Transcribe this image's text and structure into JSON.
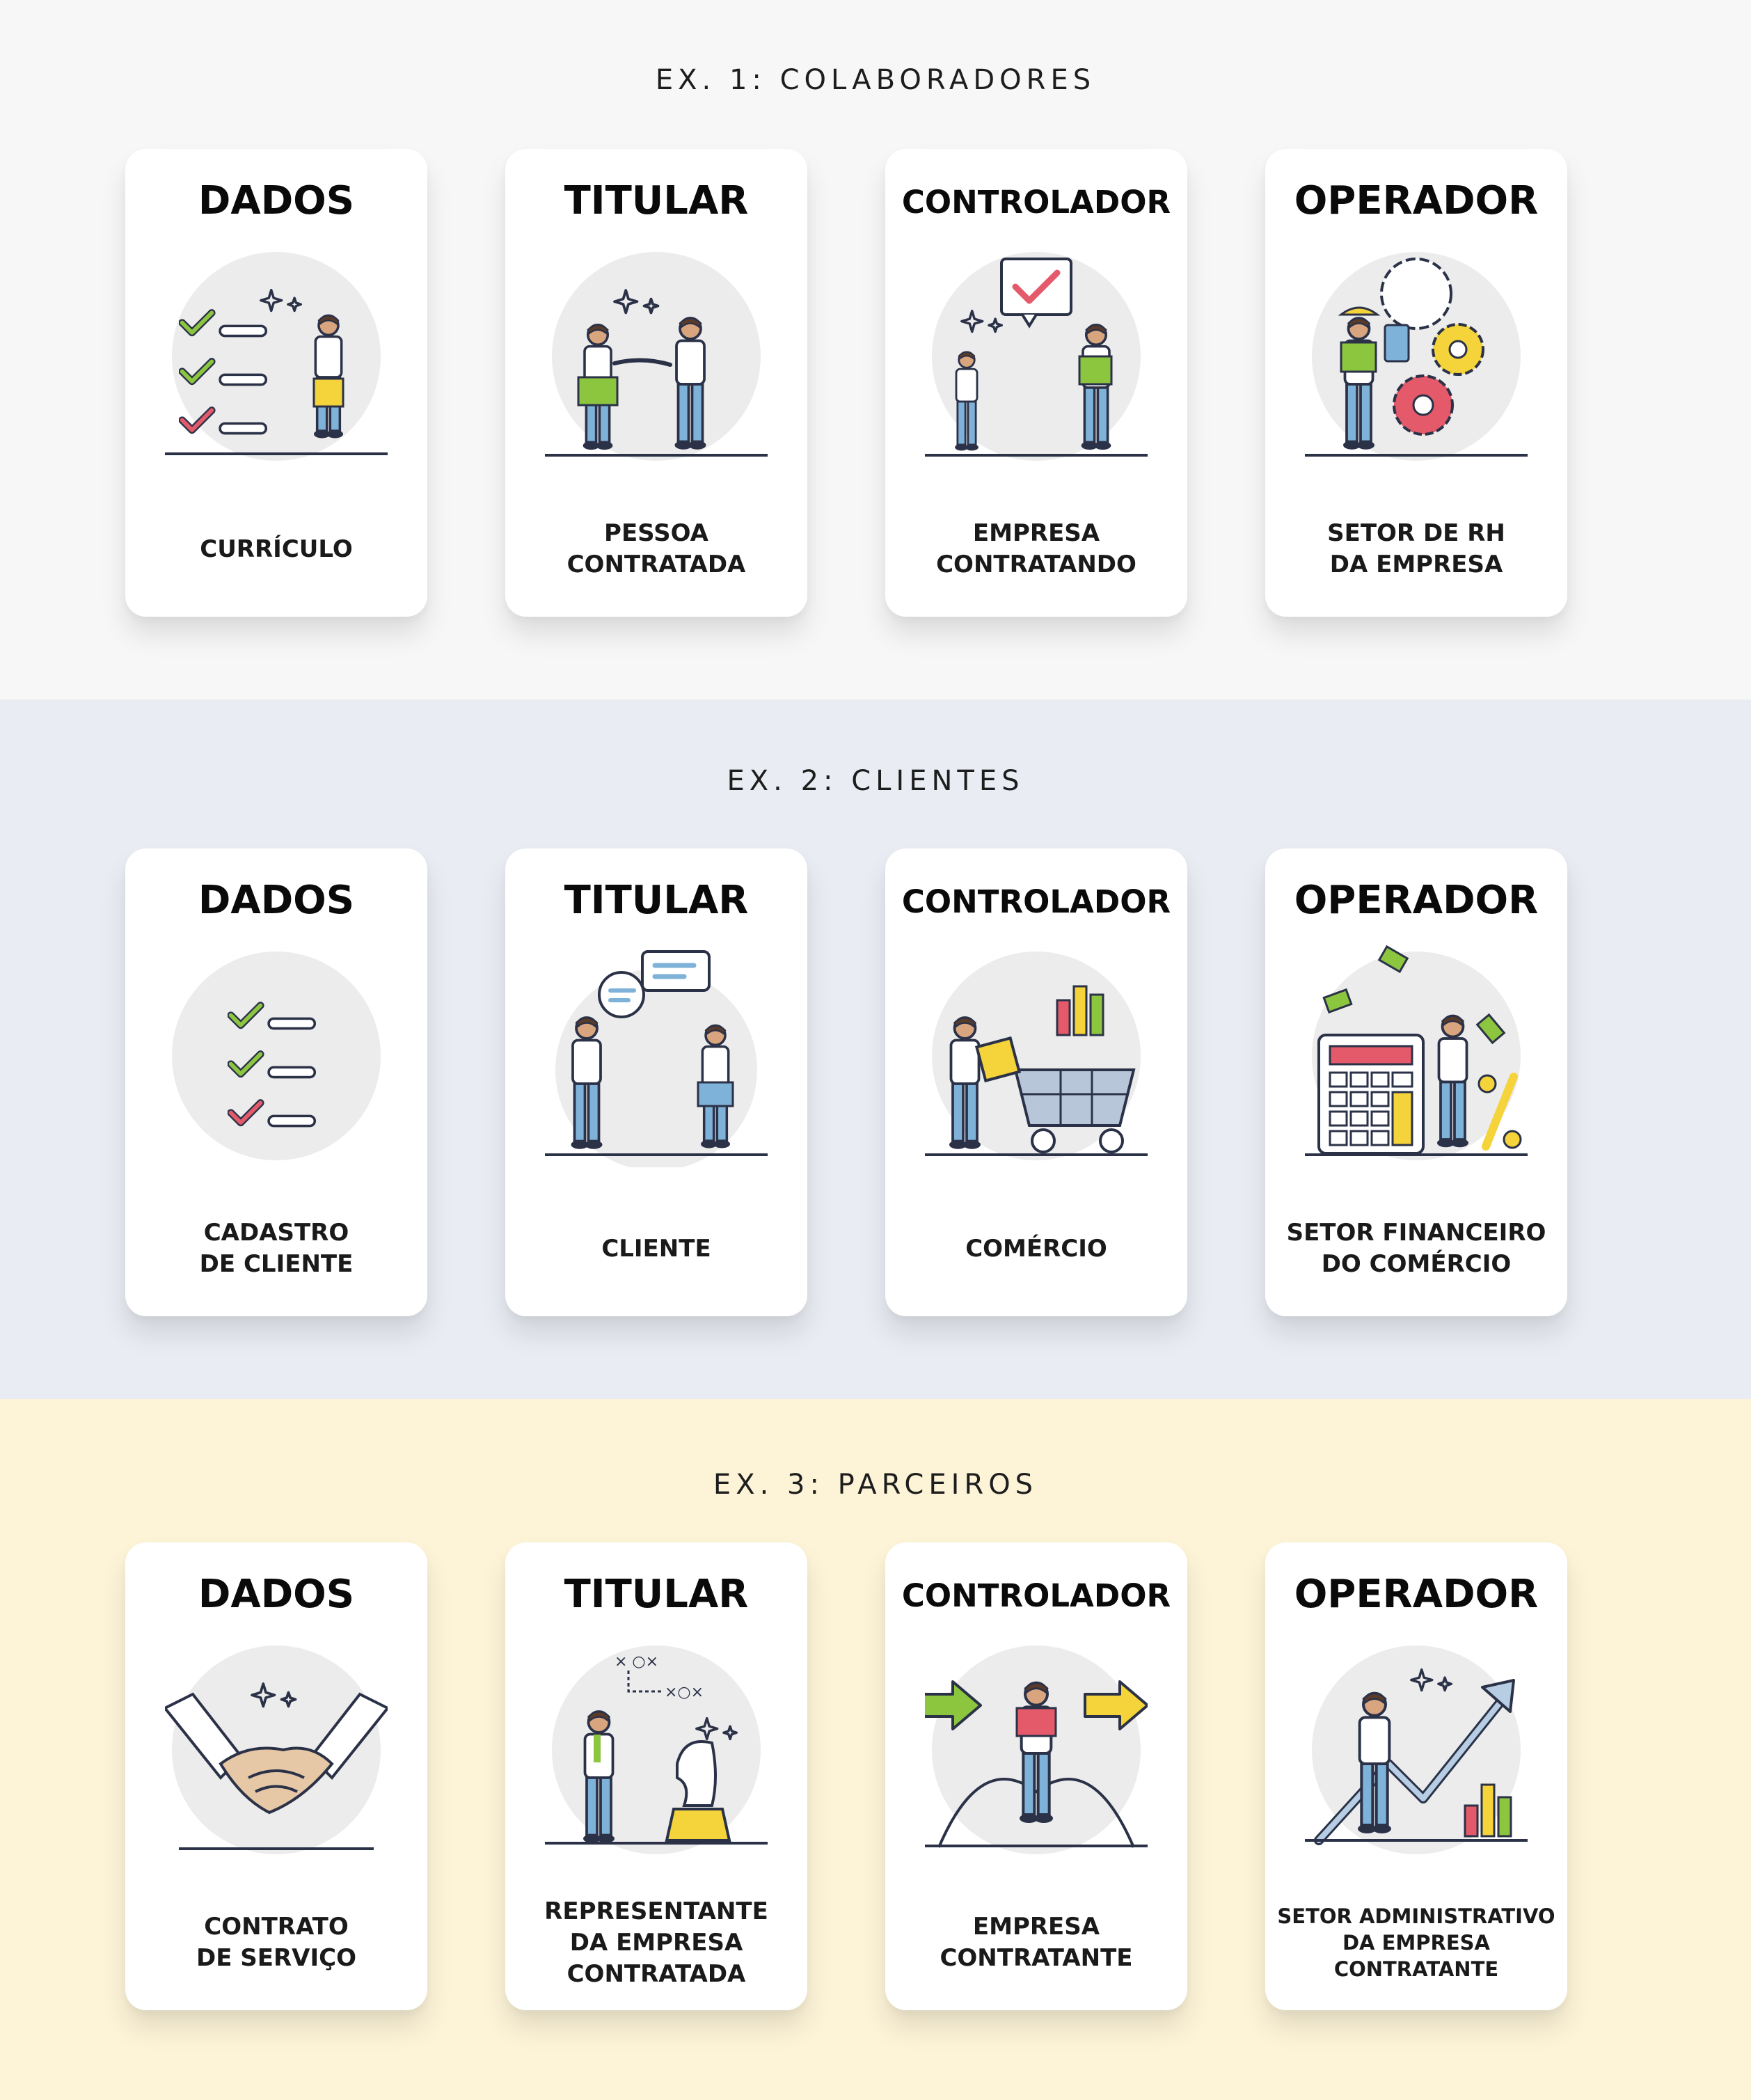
{
  "sections": [
    {
      "title": "EX. 1:  COLABORADORES",
      "cards": [
        {
          "title": "DADOS",
          "subtitle": "CURRÍCULO",
          "icon": "checklist-person-icon"
        },
        {
          "title": "TITULAR",
          "subtitle": "PESSOA\nCONTRATADA",
          "icon": "handshake-people-icon"
        },
        {
          "title": "CONTROLADOR",
          "subtitle": "EMPRESA\nCONTRATANDO",
          "icon": "interview-approval-icon"
        },
        {
          "title": "OPERADOR",
          "subtitle": "SETOR DE RH\nDA EMPRESA",
          "icon": "gears-worker-icon"
        }
      ]
    },
    {
      "title": "EX. 2:  CLIENTES",
      "cards": [
        {
          "title": "DADOS",
          "subtitle": "CADASTRO\nDE CLIENTE",
          "icon": "checklist-icon"
        },
        {
          "title": "TITULAR",
          "subtitle": "CLIENTE",
          "icon": "conversation-people-icon"
        },
        {
          "title": "CONTROLADOR",
          "subtitle": "COMÉRCIO",
          "icon": "shopping-cart-icon"
        },
        {
          "title": "OPERADOR",
          "subtitle": "SETOR FINANCEIRO\nDO COMÉRCIO",
          "icon": "calculator-money-icon"
        }
      ]
    },
    {
      "title": "EX. 3:  PARCEIROS",
      "cards": [
        {
          "title": "DADOS",
          "subtitle": "CONTRATO\nDE SERVIÇO",
          "icon": "business-handshake-icon"
        },
        {
          "title": "TITULAR",
          "subtitle": "REPRESENTANTE\nDA EMPRESA\nCONTRATADA",
          "icon": "chess-strategy-icon"
        },
        {
          "title": "CONTROLADOR",
          "subtitle": "EMPRESA\nCONTRATANTE",
          "icon": "decision-arrows-icon"
        },
        {
          "title": "OPERADOR",
          "subtitle": "SETOR ADMINISTRATIVO\nDA EMPRESA\nCONTRATANTE",
          "icon": "growth-chart-icon"
        }
      ]
    }
  ],
  "colors": {
    "navy": "#2b3248",
    "green": "#8cc63f",
    "red": "#e55a6a",
    "yellow": "#f5d33a",
    "blue": "#7fb2d9",
    "circle": "#ececec"
  }
}
